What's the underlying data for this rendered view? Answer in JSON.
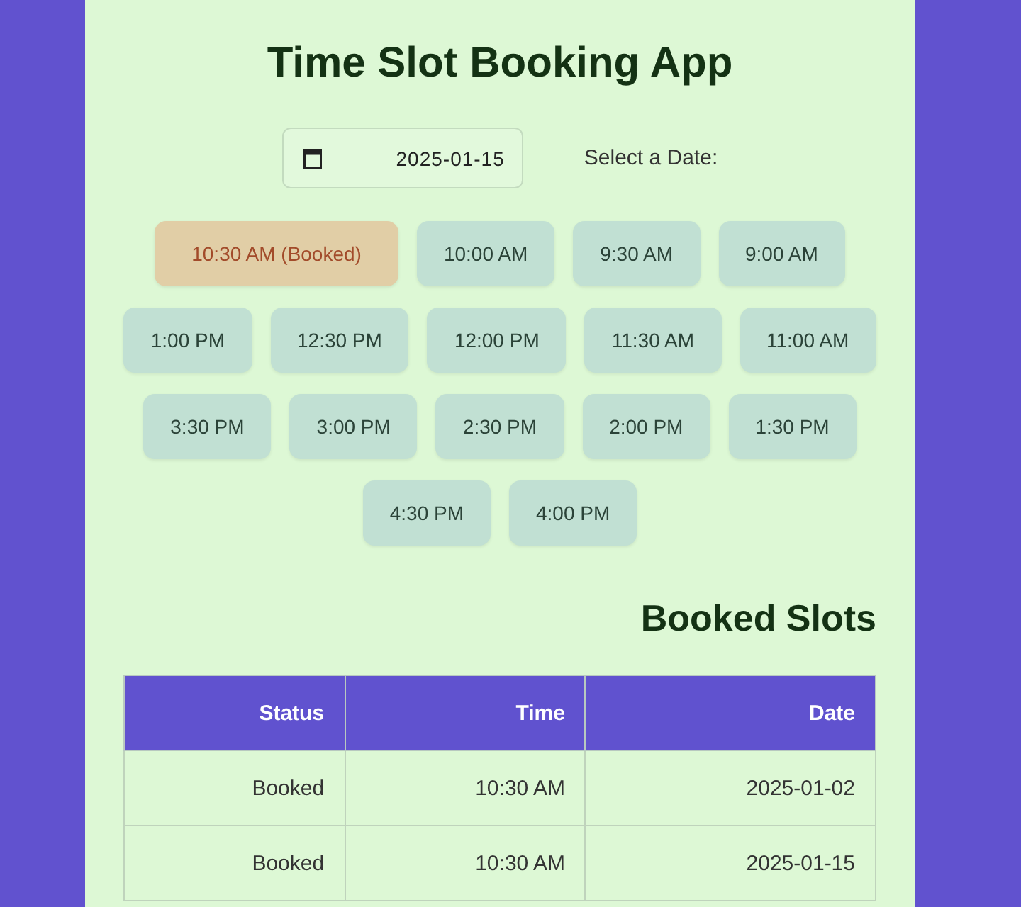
{
  "title": "Time Slot Booking App",
  "date_picker": {
    "value": "2025-01-15",
    "label": "Select a Date:"
  },
  "slot_rows": [
    [
      {
        "label": "10:30 AM (Booked)",
        "booked": true
      },
      {
        "label": "10:00 AM",
        "booked": false
      },
      {
        "label": "9:30 AM",
        "booked": false
      },
      {
        "label": "9:00 AM",
        "booked": false
      }
    ],
    [
      {
        "label": "1:00 PM",
        "booked": false
      },
      {
        "label": "12:30 PM",
        "booked": false
      },
      {
        "label": "12:00 PM",
        "booked": false
      },
      {
        "label": "11:30 AM",
        "booked": false
      },
      {
        "label": "11:00 AM",
        "booked": false
      }
    ],
    [
      {
        "label": "3:30 PM",
        "booked": false
      },
      {
        "label": "3:00 PM",
        "booked": false
      },
      {
        "label": "2:30 PM",
        "booked": false
      },
      {
        "label": "2:00 PM",
        "booked": false
      },
      {
        "label": "1:30 PM",
        "booked": false
      }
    ],
    [
      {
        "label": "4:30 PM",
        "booked": false
      },
      {
        "label": "4:00 PM",
        "booked": false
      }
    ]
  ],
  "booked_section": {
    "title": "Booked Slots",
    "table": {
      "columns": [
        "Status",
        "Time",
        "Date"
      ],
      "rows": [
        [
          "Booked",
          "10:30 AM",
          "2025-01-02"
        ],
        [
          "Booked",
          "10:30 AM",
          "2025-01-15"
        ]
      ]
    }
  }
}
